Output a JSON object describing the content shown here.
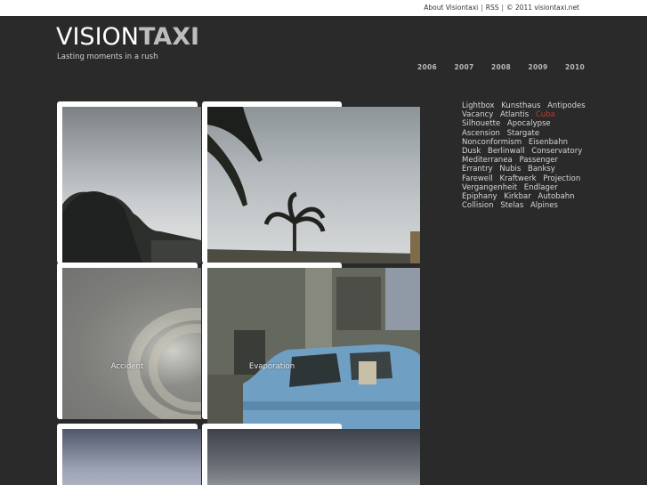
{
  "topbar": {
    "about": "About Visiontaxi",
    "sep1": "|",
    "rss": "RSS",
    "sep2": "|",
    "copyright": "© 2011 visiontaxi.net"
  },
  "logo": {
    "part1": "VISION",
    "part2": "TAXI"
  },
  "tagline": "Lasting moments in a rush",
  "years": [
    "2006",
    "2007",
    "2008",
    "2009",
    "2010"
  ],
  "tiles": [
    {
      "caption": ""
    },
    {
      "caption": ""
    },
    {
      "caption": "Accident"
    },
    {
      "caption": "Evaporation"
    },
    {
      "caption": ""
    },
    {
      "caption": ""
    }
  ],
  "cities": [
    {
      "label": "Lightbox",
      "active": false
    },
    {
      "label": "Kunsthaus",
      "active": false
    },
    {
      "label": "Antipodes",
      "active": false
    },
    {
      "label": "Vacancy",
      "active": false
    },
    {
      "label": "Atlantis",
      "active": false
    },
    {
      "label": "Cuba",
      "active": true
    },
    {
      "label": "Silhouette",
      "active": false
    },
    {
      "label": "Apocalypse",
      "active": false
    },
    {
      "label": "Ascension",
      "active": false
    },
    {
      "label": "Stargate",
      "active": false
    },
    {
      "label": "Nonconformism",
      "active": false
    },
    {
      "label": "Eisenbahn",
      "active": false
    },
    {
      "label": "Dusk",
      "active": false
    },
    {
      "label": "Berlinwall",
      "active": false
    },
    {
      "label": "Conservatory",
      "active": false
    },
    {
      "label": "Mediterranea",
      "active": false
    },
    {
      "label": "Passenger",
      "active": false
    },
    {
      "label": "Errantry",
      "active": false
    },
    {
      "label": "Nubis",
      "active": false
    },
    {
      "label": "Banksy",
      "active": false
    },
    {
      "label": "Farewell",
      "active": false
    },
    {
      "label": "Kraftwerk",
      "active": false
    },
    {
      "label": "Projection",
      "active": false
    },
    {
      "label": "Vergangenheit",
      "active": false
    },
    {
      "label": "Endlager",
      "active": false
    },
    {
      "label": "Epiphany",
      "active": false
    },
    {
      "label": "Kirkbar",
      "active": false
    },
    {
      "label": "Autobahn",
      "active": false
    },
    {
      "label": "Collision",
      "active": false
    },
    {
      "label": "Stelas",
      "active": false
    },
    {
      "label": "Alpines",
      "active": false
    }
  ],
  "colors": {
    "background": "#2a2a2a",
    "active_link": "#c0392b",
    "logo_accent": "#bdbdbd"
  }
}
